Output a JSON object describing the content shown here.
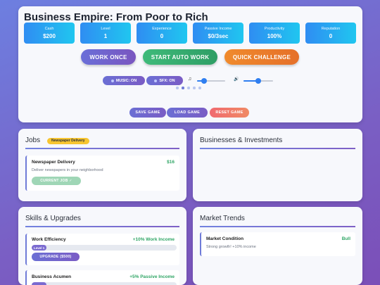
{
  "title": "Business Empire: From Poor to Rich",
  "stats": [
    {
      "label": "Cash",
      "value": "$200"
    },
    {
      "label": "Level",
      "value": "1"
    },
    {
      "label": "Experience",
      "value": "0"
    },
    {
      "label": "Passive Income",
      "value": "$0/3sec"
    },
    {
      "label": "Productivity",
      "value": "100%"
    },
    {
      "label": "Reputation",
      "value": "0"
    }
  ],
  "actions": {
    "work_once": "WORK ONCE",
    "auto_work": "START AUTO WORK",
    "quick_challenge": "QUICK CHALLENGE"
  },
  "audio": {
    "music_label": "MUSIC: ON",
    "sfx_label": "SFX: ON",
    "music_icon": "♫",
    "sfx_icon": "🔊",
    "music_volume": 0.25,
    "sfx_volume": 0.5
  },
  "pager": {
    "count": 5,
    "active": 1
  },
  "system": {
    "save": "SAVE GAME",
    "load": "LOAD GAME",
    "reset": "RESET GAME"
  },
  "jobs": {
    "title": "Jobs",
    "badge": "Newspaper Delivery",
    "items": [
      {
        "name": "Newspaper Delivery",
        "pay": "$16",
        "desc": "Deliver newspapers in your neighborhood",
        "button": "CURRENT JOB ✓"
      }
    ]
  },
  "businesses": {
    "title": "Businesses & Investments"
  },
  "skills": {
    "title": "Skills & Upgrades",
    "items": [
      {
        "name": "Work Efficiency",
        "effect": "+10% Work Income",
        "level": "Level 1",
        "progress": 0.1,
        "button": "UPGRADE ($500)"
      },
      {
        "name": "Business Acumen",
        "effect": "+5% Passive Income",
        "progress": 0.1
      }
    ]
  },
  "market": {
    "title": "Market Trends",
    "condition_label": "Market Condition",
    "condition_value": "Bull",
    "condition_desc": "Strong growth! +10% income"
  },
  "colors": {
    "accent": "#6b6fd4",
    "positive": "#2fa565",
    "warning": "#f7c531"
  }
}
